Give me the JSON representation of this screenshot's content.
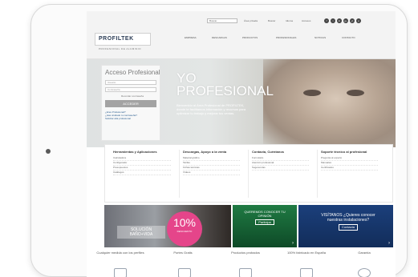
{
  "topbar": {
    "logo": "PROFILTEK",
    "tagline": "PROFESIONAL DE ALUMINIO",
    "util": [
      "Área privada",
      "Buscar",
      "Idioma",
      "Accesos"
    ],
    "search_placeholder": "Buscar",
    "social": [
      "f",
      "t",
      "in",
      "g+",
      "yt",
      "p"
    ],
    "nav": [
      "Empresa",
      "Descargas",
      "Productos",
      "Profesionales",
      "Noticias",
      "Contacto"
    ]
  },
  "login": {
    "title": "Acceso Profesional",
    "user_placeholder": "Usuario",
    "pass_placeholder": "Contraseña",
    "remember": "Recordar contraseña",
    "button": "ACCEDER",
    "links": [
      "¿Eres Profesional?",
      "¿Has olvidado tu contraseña?",
      "Solicitar alta profesional"
    ]
  },
  "hero": {
    "line1": "YO",
    "line2": "PROFESIONAL",
    "intro": "Bienvenido al Área Profesional de PROFILTEK, donde te facilitamos información y recursos para optimizar tu trabajo y mejorar tus ventas."
  },
  "features": [
    {
      "title": "Herramientas y Aplicaciones",
      "links": [
        "Calculadora",
        "Configurador",
        "Presupuestos",
        "Catálogos"
      ]
    },
    {
      "title": "Descargas, Apoyo a la venta",
      "links": [
        "Material gráfico",
        "Tarifas",
        "Fichas técnicas",
        "Vídeos"
      ]
    },
    {
      "title": "Contacta, Cuéntanos",
      "links": [
        "Formulario",
        "Atención profesional",
        "Sugerencias"
      ]
    },
    {
      "title": "Soporte técnico al profesional",
      "links": [
        "Pregunta al experto",
        "Manuales",
        "Certificados"
      ]
    }
  ],
  "banners": {
    "b1_label": "SOLUCIÓN BAÑO+VIDA",
    "b1_pct": "10%",
    "b1_sub": "DESCUENTO",
    "b2_text": "QUEREMOS CONOCER TU OPINIÓN",
    "b2_btn": "Participa",
    "b3_text": "VISÍTANOS ¿Quieres conocer nuestras instalaciones?",
    "b3_btn": "Contacta"
  },
  "footer": [
    "Cualquier medida con los perfiles",
    "Portes Gratis",
    "Productos probados",
    "100% fabricado en España",
    "Garantía"
  ]
}
